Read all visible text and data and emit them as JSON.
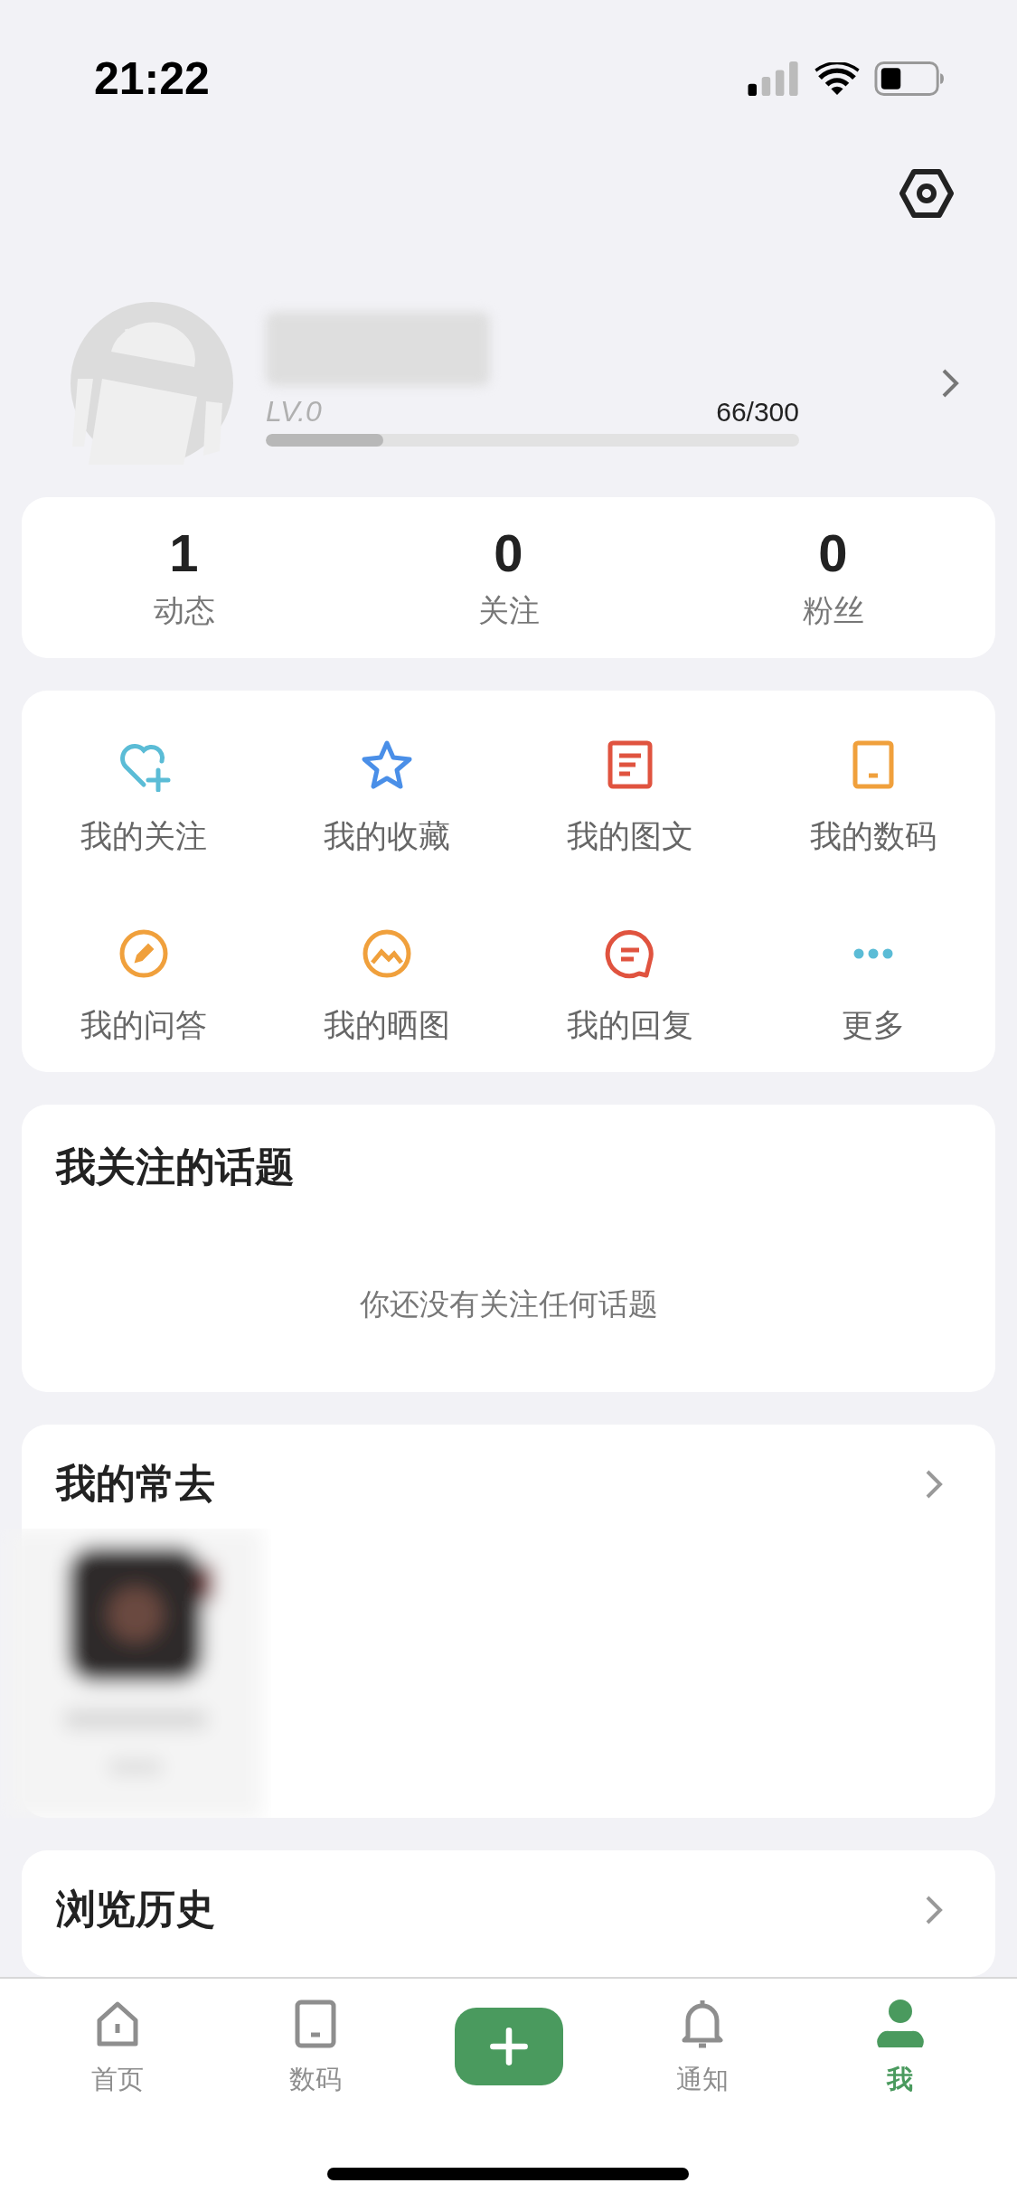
{
  "status_bar": {
    "time": "21:22"
  },
  "profile": {
    "level_label": "LV.0",
    "points": "66/300",
    "level": 0.22
  },
  "stats": [
    {
      "value": "1",
      "label": "动态"
    },
    {
      "value": "0",
      "label": "关注"
    },
    {
      "value": "0",
      "label": "粉丝"
    }
  ],
  "shortcuts": [
    {
      "label": "我的关注"
    },
    {
      "label": "我的收藏"
    },
    {
      "label": "我的图文"
    },
    {
      "label": "我的数码"
    },
    {
      "label": "我的问答"
    },
    {
      "label": "我的晒图"
    },
    {
      "label": "我的回复"
    },
    {
      "label": "更多"
    }
  ],
  "topics": {
    "title": "我关注的话题",
    "empty_text": "你还没有关注任何话题"
  },
  "frequent": {
    "title": "我的常去"
  },
  "history": {
    "title": "浏览历史"
  },
  "tab_bar": [
    {
      "kind": "tab",
      "label": "首页",
      "selected": false
    },
    {
      "kind": "tab",
      "label": "数码",
      "selected": false
    },
    {
      "kind": "add",
      "selected": false
    },
    {
      "kind": "tab",
      "label": "通知",
      "selected": false
    },
    {
      "kind": "tab",
      "label": "我",
      "selected": true
    }
  ]
}
